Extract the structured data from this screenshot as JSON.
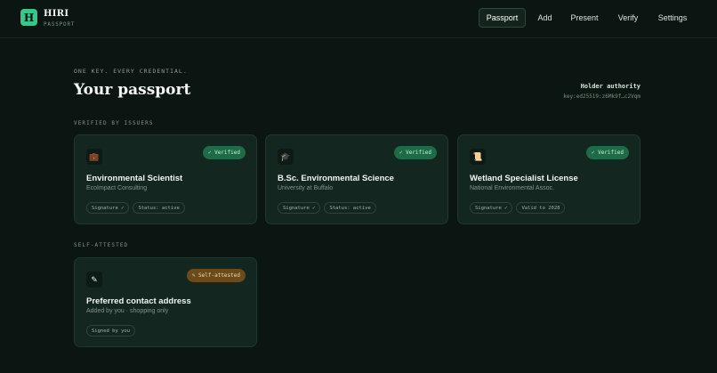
{
  "brand": {
    "logo_letter": "H",
    "name": "HIRI",
    "subtitle": "PASSPORT"
  },
  "nav": [
    {
      "label": "Passport",
      "active": true
    },
    {
      "label": "Add",
      "active": false
    },
    {
      "label": "Present",
      "active": false
    },
    {
      "label": "Verify",
      "active": false
    },
    {
      "label": "Settings",
      "active": false
    }
  ],
  "header": {
    "eyebrow": "ONE KEY. EVERY CREDENTIAL.",
    "title": "Your passport",
    "holder_label": "Holder authority",
    "holder_key": "key:ed25519:z6Mk9f…c2Vqm"
  },
  "sections": {
    "verified_label": "VERIFIED BY ISSUERS",
    "self_label": "SELF-ATTESTED"
  },
  "verified_cards": [
    {
      "icon": "briefcase-icon",
      "glyph": "💼",
      "badge": "✓ Verified",
      "title": "Environmental Scientist",
      "subtitle": "EcoImpact Consulting",
      "chips": [
        "Signature ✓",
        "Status: active"
      ]
    },
    {
      "icon": "graduation-cap-icon",
      "glyph": "🎓",
      "badge": "✓ Verified",
      "title": "B.Sc. Environmental Science",
      "subtitle": "University at Buffalo",
      "chips": [
        "Signature ✓",
        "Status: active"
      ]
    },
    {
      "icon": "scroll-icon",
      "glyph": "📜",
      "badge": "✓ Verified",
      "title": "Wetland Specialist License",
      "subtitle": "National Environmental Assoc.",
      "chips": [
        "Signature ✓",
        "Valid to 2028"
      ]
    }
  ],
  "self_cards": [
    {
      "icon": "pencil-icon",
      "glyph": "✎",
      "badge": "✎ Self-attested",
      "title": "Preferred contact address",
      "subtitle": "Added by you · shopping only",
      "chips": [
        "Signed by you"
      ]
    }
  ],
  "colors": {
    "background": "#0b1511",
    "card": "#132620",
    "accent": "#3cc48a",
    "verified_badge": "#1f6b48",
    "self_badge": "#6b4a1c"
  }
}
